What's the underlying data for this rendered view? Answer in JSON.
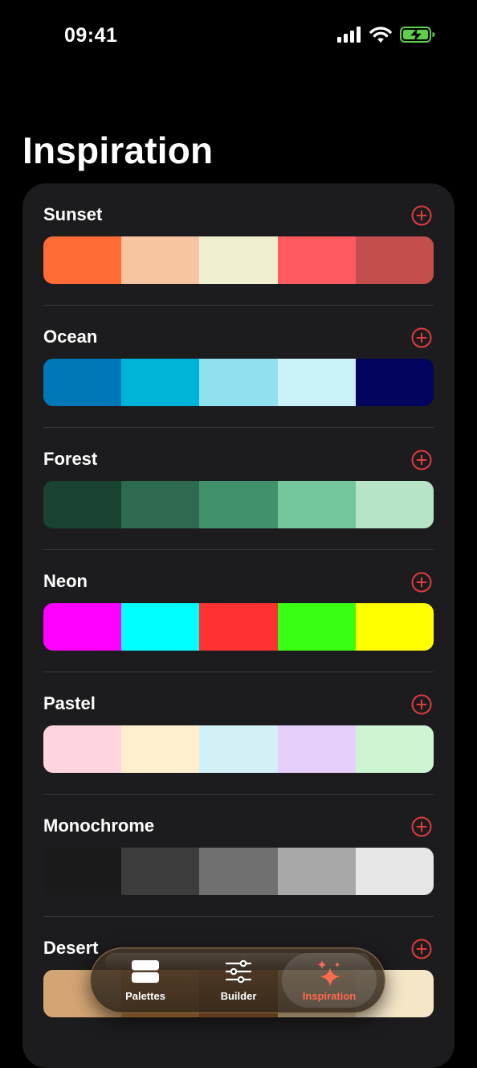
{
  "status": {
    "time": "09:41"
  },
  "title": "Inspiration",
  "accent_color": "#e23b3b",
  "palettes": [
    {
      "name": "Sunset",
      "colors": [
        "#ff6b35",
        "#f7c59f",
        "#efefd0",
        "#ff5a5f",
        "#c44d4d"
      ]
    },
    {
      "name": "Ocean",
      "colors": [
        "#0077b6",
        "#00b4d8",
        "#90e0ef",
        "#caf0f8",
        "#03045e"
      ]
    },
    {
      "name": "Forest",
      "colors": [
        "#1b4332",
        "#2d6a4f",
        "#40916c",
        "#74c69d",
        "#b7e4c7"
      ]
    },
    {
      "name": "Neon",
      "colors": [
        "#ff00ff",
        "#00ffff",
        "#ff3131",
        "#39ff14",
        "#ffff00"
      ]
    },
    {
      "name": "Pastel",
      "colors": [
        "#ffd6e0",
        "#ffefcf",
        "#d4f0f7",
        "#e7cffc",
        "#cdf5d2"
      ]
    },
    {
      "name": "Monochrome",
      "colors": [
        "#1a1a1a",
        "#3d3d3d",
        "#707070",
        "#a8a8a8",
        "#e6e6e6"
      ]
    },
    {
      "name": "Desert",
      "colors": [
        "#d4a574",
        "#c2813f",
        "#a0612e",
        "#e8c9a0",
        "#f5e6c8"
      ]
    }
  ],
  "tabs": [
    {
      "label": "Palettes",
      "icon": "palettes-icon"
    },
    {
      "label": "Builder",
      "icon": "sliders-icon"
    },
    {
      "label": "Inspiration",
      "icon": "sparkles-icon"
    }
  ]
}
